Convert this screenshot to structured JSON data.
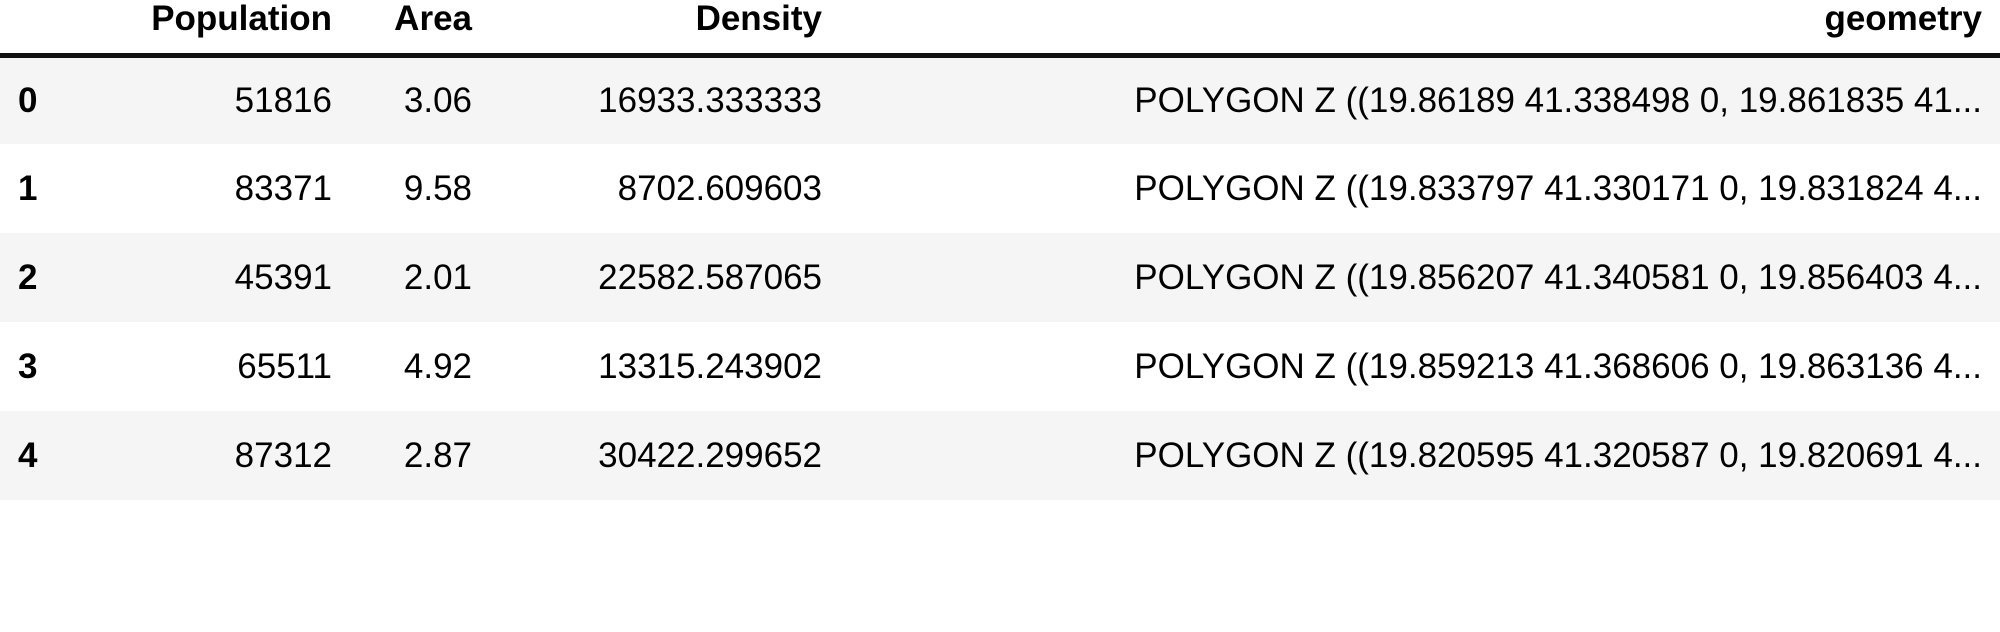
{
  "table": {
    "index_header": "",
    "columns": [
      {
        "key": "population",
        "label": "Population",
        "align": "right"
      },
      {
        "key": "area",
        "label": "Area",
        "align": "right"
      },
      {
        "key": "density",
        "label": "Density",
        "align": "right"
      },
      {
        "key": "geometry",
        "label": "geometry",
        "align": "right"
      }
    ],
    "rows": [
      {
        "index": "0",
        "population": "51816",
        "area": "3.06",
        "density": "16933.333333",
        "geometry": "POLYGON Z ((19.86189 41.338498 0, 19.861835 41..."
      },
      {
        "index": "1",
        "population": "83371",
        "area": "9.58",
        "density": "8702.609603",
        "geometry": "POLYGON Z ((19.833797 41.330171 0, 19.831824 4..."
      },
      {
        "index": "2",
        "population": "45391",
        "area": "2.01",
        "density": "22582.587065",
        "geometry": "POLYGON Z ((19.856207 41.340581 0, 19.856403 4..."
      },
      {
        "index": "3",
        "population": "65511",
        "area": "4.92",
        "density": "13315.243902",
        "geometry": "POLYGON Z ((19.859213 41.368606 0, 19.863136 4..."
      },
      {
        "index": "4",
        "population": "87312",
        "area": "2.87",
        "density": "30422.299652",
        "geometry": "POLYGON Z ((19.820595 41.320587 0, 19.820691 4..."
      }
    ]
  },
  "style": {
    "header_border_color": "#111111",
    "stripe_color": "#f5f5f5",
    "background_color": "#ffffff",
    "text_color": "#000000"
  }
}
